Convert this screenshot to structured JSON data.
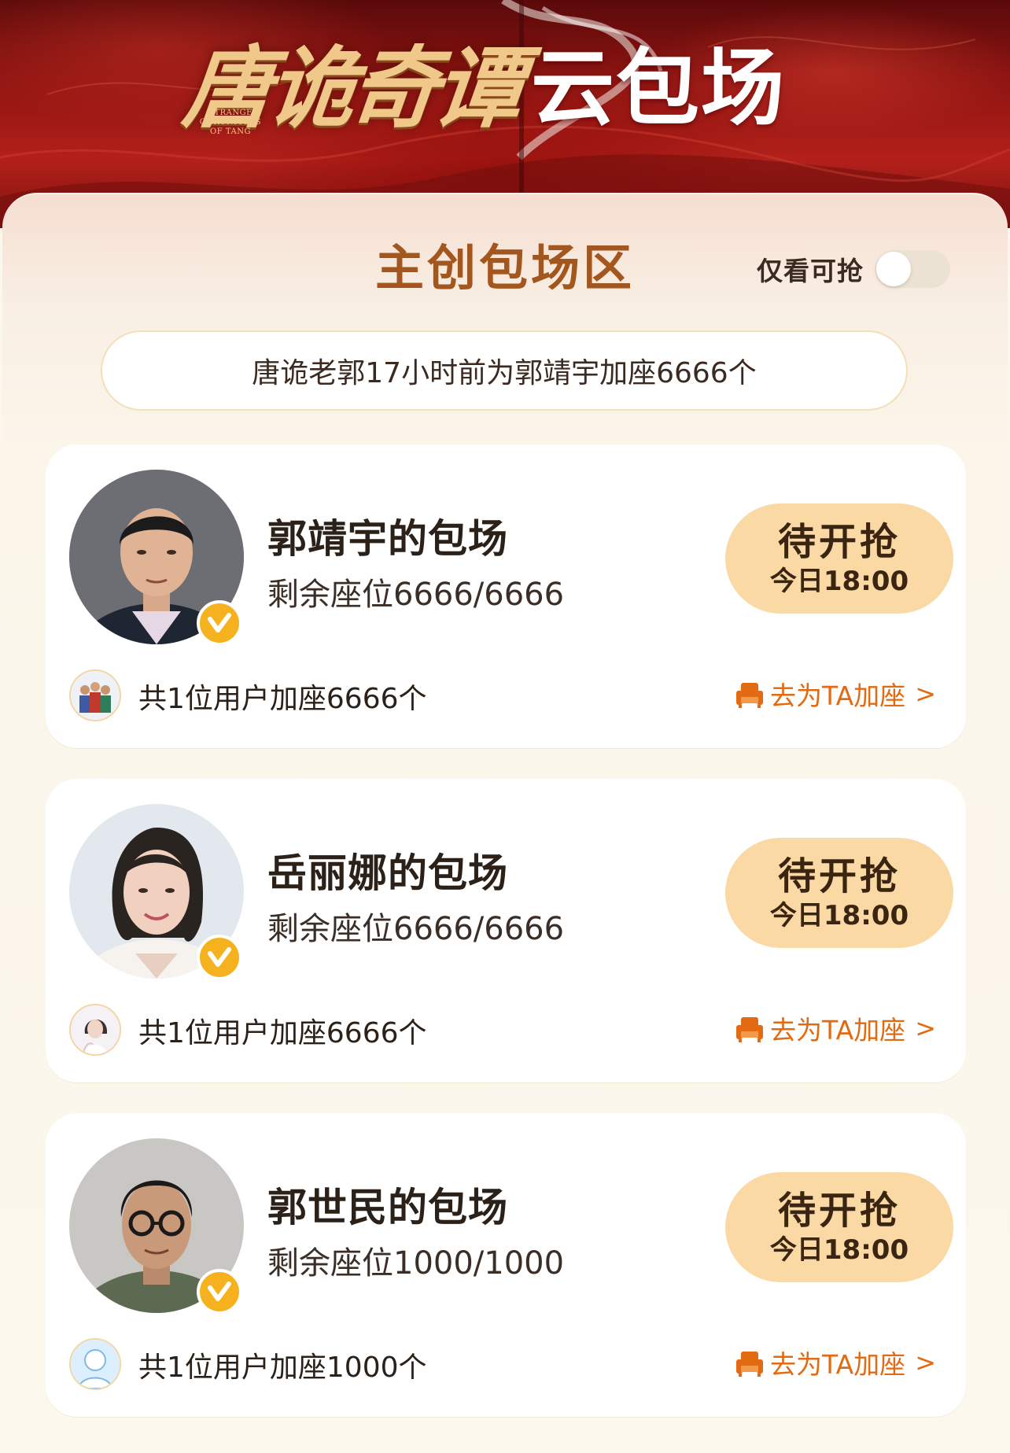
{
  "banner": {
    "title_main": "唐诡奇谭",
    "title_sub_line1": "STRANGE CHRONICLES",
    "title_sub_line2": "OF TANG",
    "title_right": "云包场"
  },
  "section": {
    "title": "主创包场区",
    "toggle_label": "仅看可抢",
    "toggle_on": false
  },
  "notice": {
    "text": "唐诡老郭17小时前为郭靖宇加座6666个"
  },
  "cards": [
    {
      "name": "郭靖宇的包场",
      "seats": "剩余座位6666/6666",
      "status": "待开抢",
      "time": "今日18:00",
      "users_text": "共1位用户加座6666个",
      "action": "去为TA加座"
    },
    {
      "name": "岳丽娜的包场",
      "seats": "剩余座位6666/6666",
      "status": "待开抢",
      "time": "今日18:00",
      "users_text": "共1位用户加座6666个",
      "action": "去为TA加座"
    },
    {
      "name": "郭世民的包场",
      "seats": "剩余座位1000/1000",
      "status": "待开抢",
      "time": "今日18:00",
      "users_text": "共1位用户加座1000个",
      "action": "去为TA加座"
    }
  ],
  "icons": {
    "verified": "verified-badge-icon",
    "action": "sofa-seat-icon",
    "chevron": "chevron-right-icon"
  },
  "colors": {
    "accent_orange": "#e26a12",
    "section_title_brown": "#a4561f",
    "button_bg": "#fbd9a4",
    "verified_gold": "#f5b21e",
    "banner_red": "#b3201a"
  }
}
